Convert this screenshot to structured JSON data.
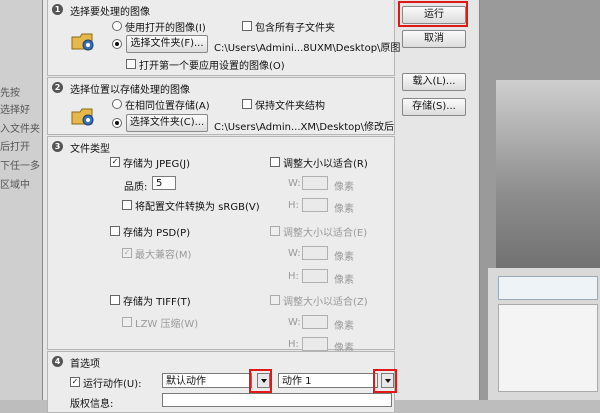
{
  "background": {
    "left_text": [
      "先按",
      "选择好",
      "入文件夹",
      "后打开",
      "下任一多",
      "区域中"
    ]
  },
  "section1": {
    "num": "1",
    "title": "选择要处理的图像",
    "use_open": "使用打开的图像(I)",
    "include_sub": "包含所有子文件夹",
    "select_folder": "选择文件夹(F)...",
    "path": "C:\\Users\\Admini...8UXM\\Desktop\\原图",
    "open_first": "打开第一个要应用设置的图像(O)"
  },
  "section2": {
    "num": "2",
    "title": "选择位置以存储处理的图像",
    "same_location": "在相同位置存储(A)",
    "keep_structure": "保持文件夹结构",
    "select_folder": "选择文件夹(C)...",
    "path": "C:\\Users\\Admin...XM\\Desktop\\修改后"
  },
  "section3": {
    "num": "3",
    "title": "文件类型",
    "jpeg": {
      "save_as": "存储为 JPEG(J)",
      "resize": "调整大小以适合(R)",
      "quality_label": "品质:",
      "quality_value": "5",
      "srgb": "将配置文件转换为 sRGB(V)",
      "w": "W:",
      "h": "H:",
      "unit": "像素"
    },
    "psd": {
      "save_as": "存储为 PSD(P)",
      "resize": "调整大小以适合(E)",
      "max_compat": "最大兼容(M)",
      "w": "W:",
      "h": "H:",
      "unit": "像素"
    },
    "tiff": {
      "save_as": "存储为 TIFF(T)",
      "resize": "调整大小以适合(Z)",
      "lzw": "LZW 压缩(W)",
      "w": "W:",
      "h": "H:",
      "unit": "像素"
    }
  },
  "section4": {
    "num": "4",
    "title": "首选项",
    "run_action": "运行动作(U):",
    "action_set": "默认动作",
    "action": "动作 1",
    "copyright": "版权信息:"
  },
  "buttons": {
    "run": "运行",
    "cancel": "取消",
    "load": "载入(L)...",
    "save": "存储(S)..."
  },
  "colors": {
    "highlight": "#e01818"
  }
}
